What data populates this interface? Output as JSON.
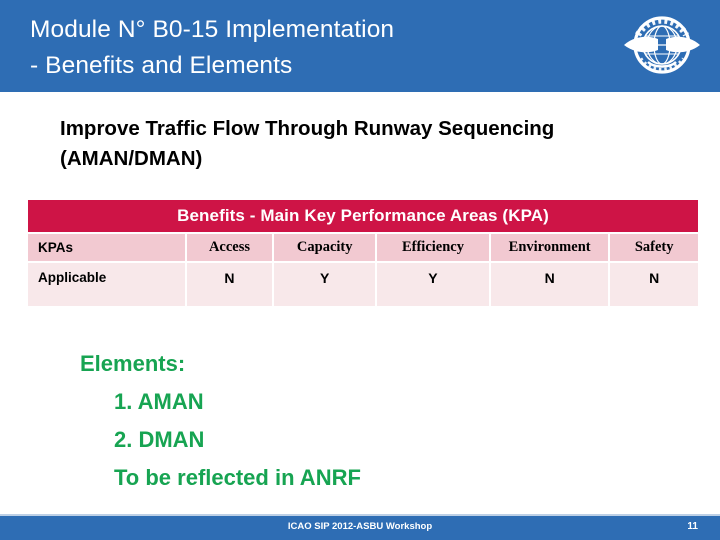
{
  "header": {
    "title": "Module N° B0-15 Implementation\n- Benefits and Elements",
    "background_color": "#2E6DB4",
    "logo_name": "icao-logo",
    "logo_text": "ICAO · OACI · ИКАО"
  },
  "subtitle": "Improve Traffic Flow Through Runway Sequencing\n(AMAN/DMAN)",
  "table": {
    "banner": "Benefits - Main Key Performance Areas (KPA)",
    "banner_color": "#CE1446",
    "header_row_color": "#F2C9D1",
    "body_row_color": "#F8E8EA",
    "columns": [
      {
        "header": "KPAs",
        "value": "Applicable"
      },
      {
        "header": "Access",
        "value": "N"
      },
      {
        "header": "Capacity",
        "value": "Y"
      },
      {
        "header": "Efficiency",
        "value": "Y"
      },
      {
        "header": "Environment",
        "value": "N"
      },
      {
        "header": "Safety",
        "value": "N"
      }
    ]
  },
  "elements": {
    "heading": "Elements:",
    "items": [
      "1. AMAN",
      "2. DMAN",
      "To be reflected in ANRF"
    ],
    "color": "#17A452"
  },
  "footer": {
    "text": "ICAO SIP 2012-ASBU Workshop",
    "page": "11",
    "background_color": "#2E6DB4"
  }
}
